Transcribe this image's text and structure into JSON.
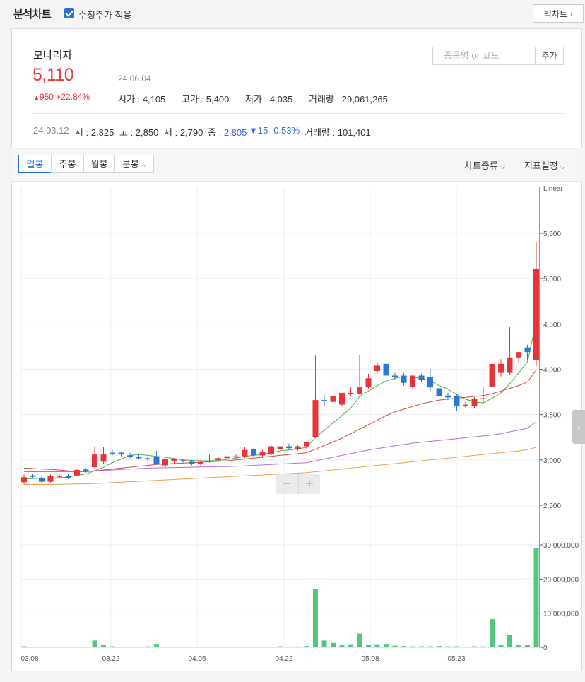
{
  "header": {
    "title": "분석차트",
    "adjusted_checkbox_label": "수정주가 적용",
    "big_chart_label": "빅차트",
    "big_chart_arrow": "›"
  },
  "stock": {
    "name": "모나리자",
    "price": "5,110",
    "date": "24.06.04",
    "change": "950 +22.84%",
    "open_label": "시가",
    "open": "4,105",
    "high_label": "고가",
    "high": "5,400",
    "low_label": "저가",
    "low": "4,035",
    "volume_label": "거래량",
    "volume": "29,061,265"
  },
  "search": {
    "placeholder": "종목명 or 코드",
    "add_label": "추가"
  },
  "hover": {
    "date": "24.03.12",
    "open_label": "시",
    "open": "2,825",
    "high_label": "고",
    "high": "2,850",
    "low_label": "저",
    "low": "2,790",
    "close_label": "종",
    "close": "2,805",
    "change": "15 -0.53%",
    "volume_label": "거래량",
    "volume": "101,401"
  },
  "tabs": [
    {
      "label": "일봉",
      "active": true
    },
    {
      "label": "주봉",
      "active": false
    },
    {
      "label": "월봉",
      "active": false
    },
    {
      "label": "분봉",
      "active": false
    }
  ],
  "menus": {
    "chart_type": "차트종류",
    "indicator": "지표설정"
  },
  "zoom": {
    "minus": "−",
    "plus": "+"
  },
  "colors": {
    "up": "#e8333a",
    "down": "#2d76d6",
    "volume": "#53c57e",
    "ma5": "#46b04a",
    "ma20": "#e0453c",
    "ma60": "#b56ae0",
    "ma120": "#eda04c"
  },
  "chart_data": {
    "type": "candlestick",
    "scale_label": "Linear",
    "price_axis": {
      "ticks": [
        "5,500",
        "5,000",
        "4,500",
        "4,000",
        "3,500",
        "3,000",
        "2,500"
      ],
      "ylim": [
        2500,
        5500
      ]
    },
    "volume_axis": {
      "ticks": [
        "30,000,000",
        "20,000,000",
        "10,000,000",
        "0"
      ],
      "ylim": [
        0,
        30000000
      ]
    },
    "x_ticks": [
      "03.08",
      "03.22",
      "04.05",
      "04.22",
      "05.08",
      "05.23"
    ],
    "candles": [
      {
        "o": 2755,
        "h": 2840,
        "l": 2730,
        "c": 2810
      },
      {
        "o": 2830,
        "h": 2850,
        "l": 2800,
        "c": 2815
      },
      {
        "o": 2805,
        "h": 2830,
        "l": 2750,
        "c": 2760
      },
      {
        "o": 2760,
        "h": 2840,
        "l": 2750,
        "c": 2820
      },
      {
        "o": 2815,
        "h": 2840,
        "l": 2790,
        "c": 2825
      },
      {
        "o": 2825,
        "h": 2850,
        "l": 2790,
        "c": 2805
      },
      {
        "o": 2830,
        "h": 2900,
        "l": 2820,
        "c": 2890
      },
      {
        "o": 2895,
        "h": 2910,
        "l": 2860,
        "c": 2875
      },
      {
        "o": 2920,
        "h": 3150,
        "l": 2900,
        "c": 3060
      },
      {
        "o": 2980,
        "h": 3140,
        "l": 2960,
        "c": 3060
      },
      {
        "o": 3080,
        "h": 3110,
        "l": 3050,
        "c": 3070
      },
      {
        "o": 3080,
        "h": 3090,
        "l": 3040,
        "c": 3060
      },
      {
        "o": 3050,
        "h": 3080,
        "l": 3020,
        "c": 3030
      },
      {
        "o": 3030,
        "h": 3070,
        "l": 3010,
        "c": 3020
      },
      {
        "o": 3020,
        "h": 3040,
        "l": 2990,
        "c": 3010
      },
      {
        "o": 3030,
        "h": 3100,
        "l": 2950,
        "c": 2950
      },
      {
        "o": 2940,
        "h": 3020,
        "l": 2920,
        "c": 3010
      },
      {
        "o": 2990,
        "h": 3020,
        "l": 2960,
        "c": 3010
      },
      {
        "o": 2995,
        "h": 3010,
        "l": 2970,
        "c": 2985
      },
      {
        "o": 2980,
        "h": 3000,
        "l": 2940,
        "c": 2960
      },
      {
        "o": 2955,
        "h": 3000,
        "l": 2930,
        "c": 2980
      },
      {
        "o": 2990,
        "h": 3060,
        "l": 2970,
        "c": 2990
      },
      {
        "o": 3000,
        "h": 3030,
        "l": 2980,
        "c": 3020
      },
      {
        "o": 3020,
        "h": 3060,
        "l": 3000,
        "c": 3040
      },
      {
        "o": 3040,
        "h": 3060,
        "l": 3020,
        "c": 3040
      },
      {
        "o": 3040,
        "h": 3140,
        "l": 3020,
        "c": 3110
      },
      {
        "o": 3120,
        "h": 3130,
        "l": 3030,
        "c": 3050
      },
      {
        "o": 3050,
        "h": 3110,
        "l": 3030,
        "c": 3090
      },
      {
        "o": 3060,
        "h": 3160,
        "l": 3050,
        "c": 3150
      },
      {
        "o": 3120,
        "h": 3170,
        "l": 3090,
        "c": 3150
      },
      {
        "o": 3150,
        "h": 3180,
        "l": 3110,
        "c": 3130
      },
      {
        "o": 3120,
        "h": 3170,
        "l": 3100,
        "c": 3150
      },
      {
        "o": 3150,
        "h": 3200,
        "l": 3120,
        "c": 3200
      },
      {
        "o": 3250,
        "h": 4150,
        "l": 3240,
        "c": 3660
      },
      {
        "o": 3660,
        "h": 3720,
        "l": 3600,
        "c": 3650
      },
      {
        "o": 3640,
        "h": 3750,
        "l": 3620,
        "c": 3700
      },
      {
        "o": 3610,
        "h": 3730,
        "l": 3600,
        "c": 3740
      },
      {
        "o": 3740,
        "h": 3800,
        "l": 3700,
        "c": 3740
      },
      {
        "o": 3730,
        "h": 4160,
        "l": 3720,
        "c": 3800
      },
      {
        "o": 3800,
        "h": 3950,
        "l": 3780,
        "c": 3900
      },
      {
        "o": 3980,
        "h": 4080,
        "l": 3960,
        "c": 4040
      },
      {
        "o": 4060,
        "h": 4170,
        "l": 3920,
        "c": 3930
      },
      {
        "o": 3930,
        "h": 3960,
        "l": 3880,
        "c": 3910
      },
      {
        "o": 3930,
        "h": 3960,
        "l": 3820,
        "c": 3850
      },
      {
        "o": 3800,
        "h": 3930,
        "l": 3780,
        "c": 3930
      },
      {
        "o": 3930,
        "h": 3950,
        "l": 3860,
        "c": 3880
      },
      {
        "o": 3910,
        "h": 4000,
        "l": 3760,
        "c": 3800
      },
      {
        "o": 3790,
        "h": 3800,
        "l": 3670,
        "c": 3700
      },
      {
        "o": 3710,
        "h": 3740,
        "l": 3660,
        "c": 3690
      },
      {
        "o": 3700,
        "h": 3720,
        "l": 3540,
        "c": 3590
      },
      {
        "o": 3590,
        "h": 3640,
        "l": 3570,
        "c": 3610
      },
      {
        "o": 3590,
        "h": 3690,
        "l": 3570,
        "c": 3670
      },
      {
        "o": 3680,
        "h": 3800,
        "l": 3640,
        "c": 3680
      },
      {
        "o": 3810,
        "h": 4500,
        "l": 3780,
        "c": 4060
      },
      {
        "o": 3960,
        "h": 4110,
        "l": 3920,
        "c": 4060
      },
      {
        "o": 3960,
        "h": 4470,
        "l": 3940,
        "c": 4130
      },
      {
        "o": 4130,
        "h": 4190,
        "l": 4080,
        "c": 4190
      },
      {
        "o": 4240,
        "h": 4270,
        "l": 4100,
        "c": 4190
      },
      {
        "o": 4105,
        "h": 5400,
        "l": 4035,
        "c": 5110
      }
    ],
    "volumes": [
      300000,
      200000,
      200000,
      200000,
      150000,
      101401,
      200000,
      200000,
      2000000,
      700000,
      300000,
      200000,
      200000,
      200000,
      300000,
      1000000,
      200000,
      200000,
      150000,
      150000,
      150000,
      200000,
      200000,
      150000,
      150000,
      200000,
      150000,
      200000,
      200000,
      300000,
      250000,
      250000,
      400000,
      17000000,
      2000000,
      1300000,
      800000,
      900000,
      4000000,
      800000,
      900000,
      1000000,
      500000,
      400000,
      300000,
      300000,
      300000,
      400000,
      300000,
      300000,
      200000,
      300000,
      300000,
      8300000,
      700000,
      3600000,
      700000,
      800000,
      29061265
    ],
    "series": [
      {
        "name": "MA5",
        "values": [
          2790,
          2795,
          2800,
          2800,
          2805,
          2810,
          2830,
          2845,
          2880,
          2920,
          2970,
          3010,
          3050,
          3060,
          3050,
          3040,
          3030,
          3015,
          3000,
          2995,
          2990,
          2990,
          2995,
          3005,
          3020,
          3040,
          3050,
          3060,
          3080,
          3100,
          3110,
          3120,
          3140,
          3250,
          3330,
          3410,
          3490,
          3570,
          3700,
          3760,
          3820,
          3870,
          3900,
          3920,
          3910,
          3900,
          3870,
          3820,
          3780,
          3720,
          3670,
          3640,
          3630,
          3680,
          3740,
          3840,
          3960,
          4080,
          4530
        ]
      },
      {
        "name": "MA20",
        "values": [
          2910,
          2905,
          2900,
          2895,
          2890,
          2880,
          2870,
          2870,
          2880,
          2890,
          2900,
          2910,
          2920,
          2930,
          2940,
          2950,
          2955,
          2960,
          2965,
          2970,
          2975,
          2980,
          2985,
          2990,
          3000,
          3010,
          3020,
          3030,
          3040,
          3050,
          3060,
          3070,
          3080,
          3120,
          3160,
          3200,
          3240,
          3290,
          3340,
          3390,
          3440,
          3490,
          3530,
          3560,
          3590,
          3620,
          3640,
          3660,
          3670,
          3680,
          3690,
          3700,
          3710,
          3730,
          3760,
          3790,
          3820,
          3860,
          3990
        ]
      },
      {
        "name": "MA60",
        "values": [
          2870,
          2870,
          2870,
          2870,
          2870,
          2870,
          2870,
          2875,
          2880,
          2885,
          2890,
          2895,
          2900,
          2905,
          2910,
          2912,
          2914,
          2916,
          2918,
          2920,
          2922,
          2924,
          2926,
          2928,
          2930,
          2935,
          2940,
          2945,
          2950,
          2955,
          2960,
          2965,
          2970,
          2990,
          3010,
          3030,
          3050,
          3070,
          3090,
          3110,
          3125,
          3140,
          3155,
          3170,
          3185,
          3195,
          3205,
          3215,
          3225,
          3235,
          3245,
          3255,
          3265,
          3275,
          3290,
          3310,
          3330,
          3350,
          3420
        ]
      },
      {
        "name": "MA120",
        "values": [
          2730,
          2730,
          2730,
          2730,
          2732,
          2734,
          2736,
          2738,
          2740,
          2745,
          2750,
          2755,
          2760,
          2765,
          2770,
          2775,
          2780,
          2785,
          2790,
          2795,
          2800,
          2805,
          2810,
          2815,
          2820,
          2825,
          2830,
          2835,
          2840,
          2845,
          2850,
          2855,
          2860,
          2870,
          2880,
          2890,
          2900,
          2910,
          2920,
          2930,
          2940,
          2950,
          2960,
          2970,
          2980,
          2990,
          3000,
          3010,
          3020,
          3030,
          3040,
          3050,
          3060,
          3070,
          3080,
          3090,
          3100,
          3115,
          3140
        ]
      }
    ]
  }
}
